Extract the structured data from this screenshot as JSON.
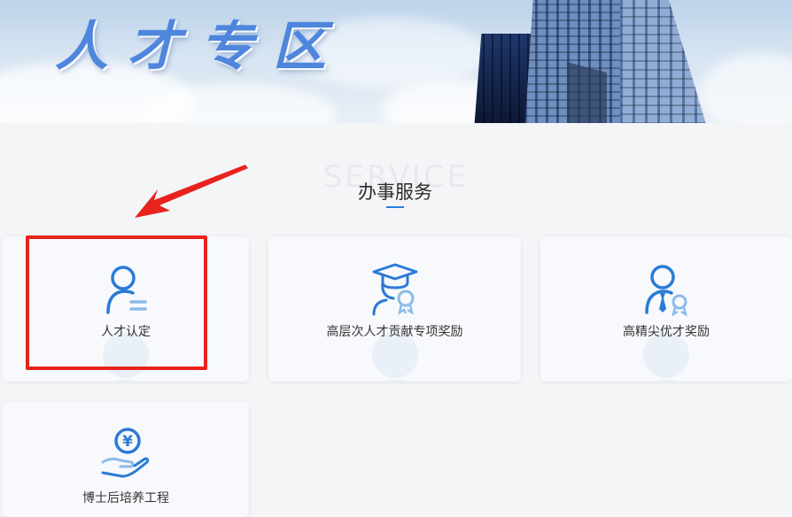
{
  "banner": {
    "title": "人才专区"
  },
  "section": {
    "bg_word": "SERVICE",
    "title": "办事服务"
  },
  "cards": [
    {
      "label": "人才认定",
      "icon": "person-id-icon"
    },
    {
      "label": "高层次人才贡献专项奖励",
      "icon": "graduate-award-icon"
    },
    {
      "label": "高精尖优才奖励",
      "icon": "person-tie-award-icon"
    },
    {
      "label": "博士后培养工程",
      "icon": "yen-hand-icon"
    }
  ],
  "colors": {
    "icon_primary": "#2a7bd6",
    "icon_light": "#8cbbe8",
    "annotation": "#e8231d",
    "accent": "#2b7be0"
  }
}
